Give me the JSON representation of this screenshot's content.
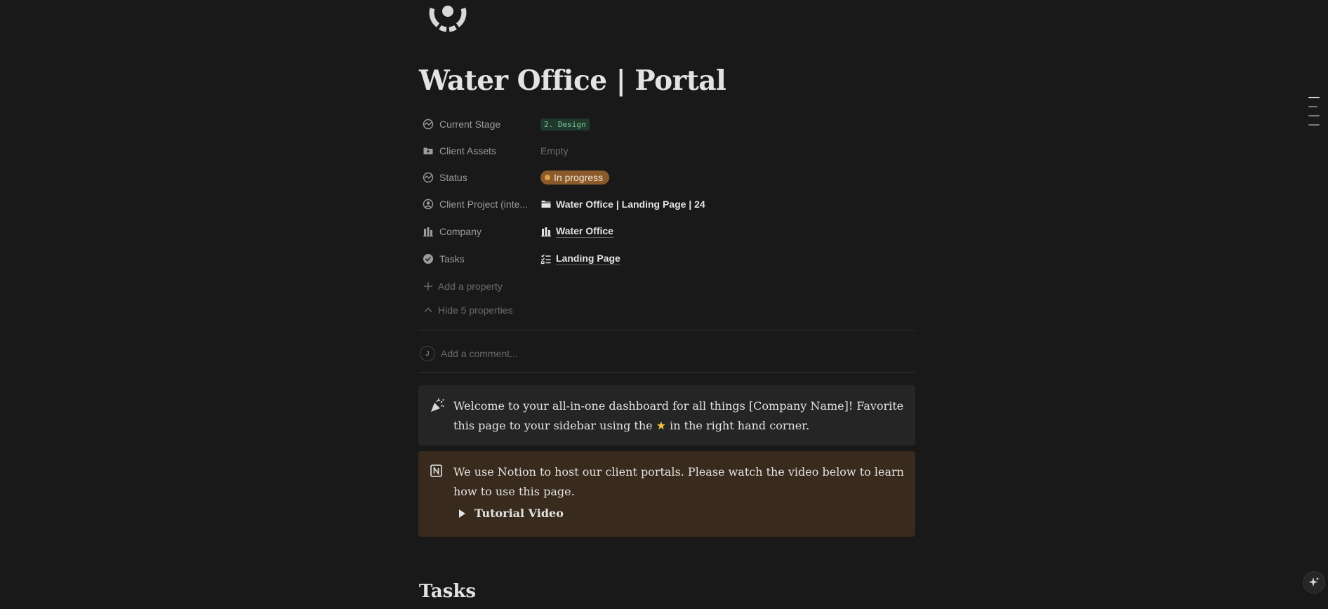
{
  "page": {
    "title": "Water Office | Portal",
    "icon": "dashboard-logo-icon"
  },
  "properties": [
    {
      "name": "Current Stage",
      "icon": "status-icon",
      "type": "tag",
      "value": "2. Design"
    },
    {
      "name": "Client Assets",
      "icon": "folder-icon",
      "type": "empty",
      "value": "Empty"
    },
    {
      "name": "Status",
      "icon": "status-icon",
      "type": "status",
      "value": "In progress"
    },
    {
      "name": "Client Project (inte...",
      "icon": "person-circle-icon",
      "type": "relation",
      "value": "Water Office | Landing Page | 24",
      "value_icon": "folder-icon"
    },
    {
      "name": "Company",
      "icon": "building-icon",
      "type": "relation",
      "value": "Water Office",
      "value_icon": "building-icon"
    },
    {
      "name": "Tasks",
      "icon": "check-circle-icon",
      "type": "relation",
      "value": "Landing Page",
      "value_icon": "checklist-icon"
    }
  ],
  "add_property_label": "Add a property",
  "hide_properties_label": "Hide 5 properties",
  "comment": {
    "avatar_initial": "J",
    "placeholder": "Add a comment..."
  },
  "callouts": [
    {
      "icon": "party-popper-icon",
      "text_before_star": "Welcome to your all-in-one dashboard for all things [Company Name]! Favorite this page to your sidebar using the",
      "star": "★",
      "text_after_star": "in the right hand corner."
    },
    {
      "icon": "notion-logo-icon",
      "text": "We use Notion to host our client portals. Please watch the video below to learn how to use this page.",
      "toggle_label": "Tutorial Video"
    }
  ],
  "section_heading": "Tasks",
  "colors": {
    "background": "#191919",
    "design_tag_bg": "#1f3a2c",
    "design_tag_fg": "#7fc99a",
    "status_bg": "#8a5a2b",
    "status_dot": "#e0a045",
    "callout_gray": "#252525",
    "callout_brown": "#382a1c"
  }
}
